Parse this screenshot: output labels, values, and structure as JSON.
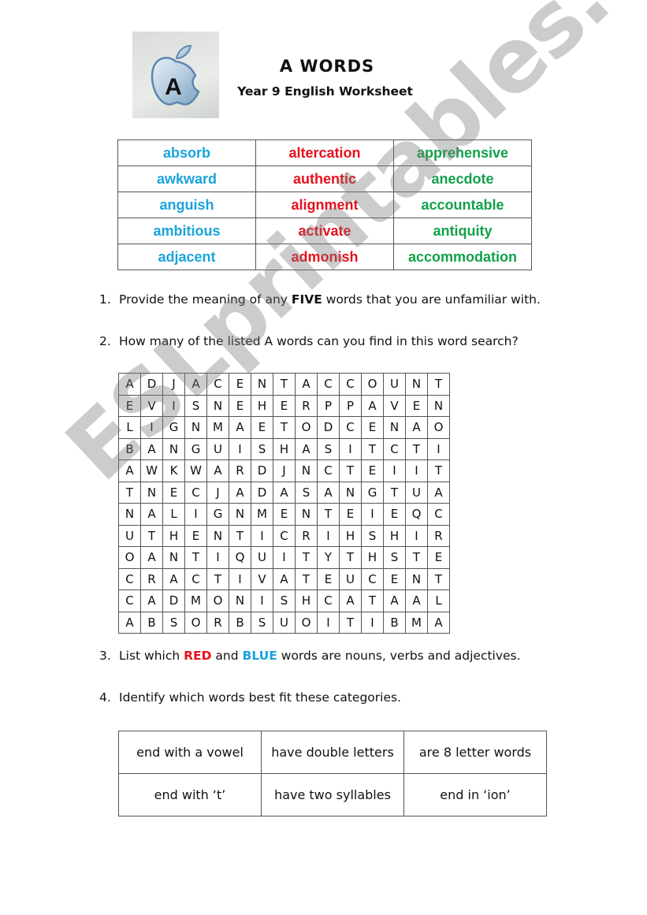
{
  "header": {
    "logo_letter": "A",
    "logo_icon": "apple-icon",
    "title": "A WORDS",
    "subtitle": "Year 9 English Worksheet"
  },
  "colors": {
    "blue": "#1aa3dc",
    "red": "#e8101c",
    "green": "#12a14a"
  },
  "word_table": {
    "rows": [
      [
        "absorb",
        "altercation",
        "apprehensive"
      ],
      [
        "awkward",
        "authentic",
        "anecdote"
      ],
      [
        "anguish",
        "alignment",
        "accountable"
      ],
      [
        "ambitious",
        "activate",
        "antiquity"
      ],
      [
        "adjacent",
        "admonish",
        "accommodation"
      ]
    ],
    "column_colors": [
      "blue",
      "red",
      "green"
    ]
  },
  "questions": [
    {
      "number": "1.",
      "before": "Provide the meaning of any ",
      "emph": "FIVE",
      "after": " words that you are unfamiliar with."
    },
    {
      "number": "2.",
      "text": "How many of the listed A words can you find in this word search?"
    },
    {
      "number": "3.",
      "before": "List which ",
      "red": "RED",
      "mid": " and ",
      "blue": "BLUE",
      "after": " words are nouns, verbs and adjectives."
    },
    {
      "number": "4.",
      "text": "Identify which words best fit these categories."
    }
  ],
  "word_search": {
    "rows": [
      [
        "A",
        "D",
        "J",
        "A",
        "C",
        "E",
        "N",
        "T",
        "A",
        "C",
        "C",
        "O",
        "U",
        "N",
        "T"
      ],
      [
        "E",
        "V",
        "I",
        "S",
        "N",
        "E",
        "H",
        "E",
        "R",
        "P",
        "P",
        "A",
        "V",
        "E",
        "N"
      ],
      [
        "L",
        "I",
        "G",
        "N",
        "M",
        "A",
        "E",
        "T",
        "O",
        "D",
        "C",
        "E",
        "N",
        "A",
        "O"
      ],
      [
        "B",
        "A",
        "N",
        "G",
        "U",
        "I",
        "S",
        "H",
        "A",
        "S",
        "I",
        "T",
        "C",
        "T",
        "I"
      ],
      [
        "A",
        "W",
        "K",
        "W",
        "A",
        "R",
        "D",
        "J",
        "N",
        "C",
        "T",
        "E",
        "I",
        "I",
        "T"
      ],
      [
        "T",
        "N",
        "E",
        "C",
        "J",
        "A",
        "D",
        "A",
        "S",
        "A",
        "N",
        "G",
        "T",
        "U",
        "A"
      ],
      [
        "N",
        "A",
        "L",
        "I",
        "G",
        "N",
        "M",
        "E",
        "N",
        "T",
        "E",
        "I",
        "E",
        "Q",
        "C"
      ],
      [
        "U",
        "T",
        "H",
        "E",
        "N",
        "T",
        "I",
        "C",
        "R",
        "I",
        "H",
        "S",
        "H",
        "I",
        "R"
      ],
      [
        "O",
        "A",
        "N",
        "T",
        "I",
        "Q",
        "U",
        "I",
        "T",
        "Y",
        "T",
        "H",
        "S",
        "T",
        "E"
      ],
      [
        "C",
        "R",
        "A",
        "C",
        "T",
        "I",
        "V",
        "A",
        "T",
        "E",
        "U",
        "C",
        "E",
        "N",
        "T"
      ],
      [
        "C",
        "A",
        "D",
        "M",
        "O",
        "N",
        "I",
        "S",
        "H",
        "C",
        "A",
        "T",
        "A",
        "A",
        "L"
      ],
      [
        "A",
        "B",
        "S",
        "O",
        "R",
        "B",
        "S",
        "U",
        "O",
        "I",
        "T",
        "I",
        "B",
        "M",
        "A"
      ]
    ]
  },
  "categories": {
    "rows": [
      [
        "end with a vowel",
        "have double letters",
        "are 8 letter words"
      ],
      [
        "end with ‘t’",
        "have two syllables",
        "end in ‘ion’"
      ]
    ]
  },
  "watermark": "ESLprintables.com"
}
